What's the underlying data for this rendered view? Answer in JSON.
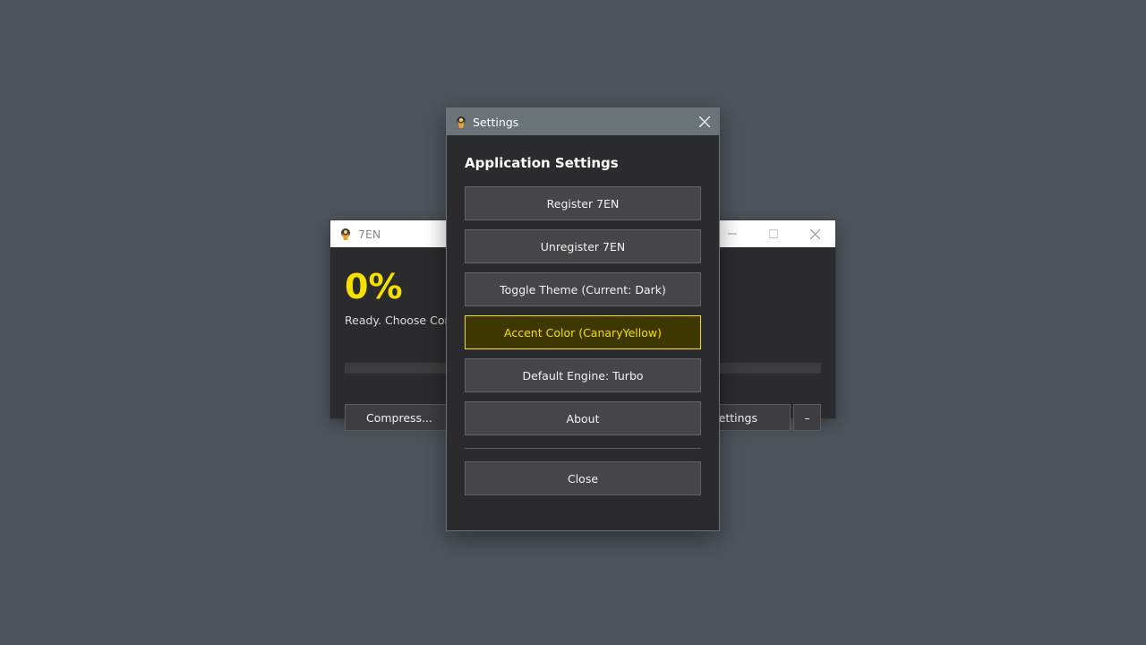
{
  "main_window": {
    "title": "7EN",
    "percent": "0%",
    "progress": 0,
    "status": "Ready. Choose Com",
    "compress_label": "Compress...",
    "settings_label": "Settings",
    "minimize_label": "–"
  },
  "settings": {
    "title": "Settings",
    "heading": "Application Settings",
    "buttons": {
      "register": "Register 7EN",
      "unregister": "Unregister 7EN",
      "toggle_theme": "Toggle Theme (Current: Dark)",
      "accent_color": "Accent Color (CanaryYellow)",
      "default_engine": "Default Engine: Turbo",
      "about": "About",
      "close": "Close"
    }
  },
  "colors": {
    "accent": "#f5e000",
    "desktop": "#4d545c",
    "window_bg": "#2b2b2d",
    "dialog_titlebar": "#6b7479"
  },
  "icons": {
    "app": "7en-app-icon",
    "close": "close-icon",
    "minimize": "minimize-icon",
    "maximize": "maximize-icon"
  }
}
